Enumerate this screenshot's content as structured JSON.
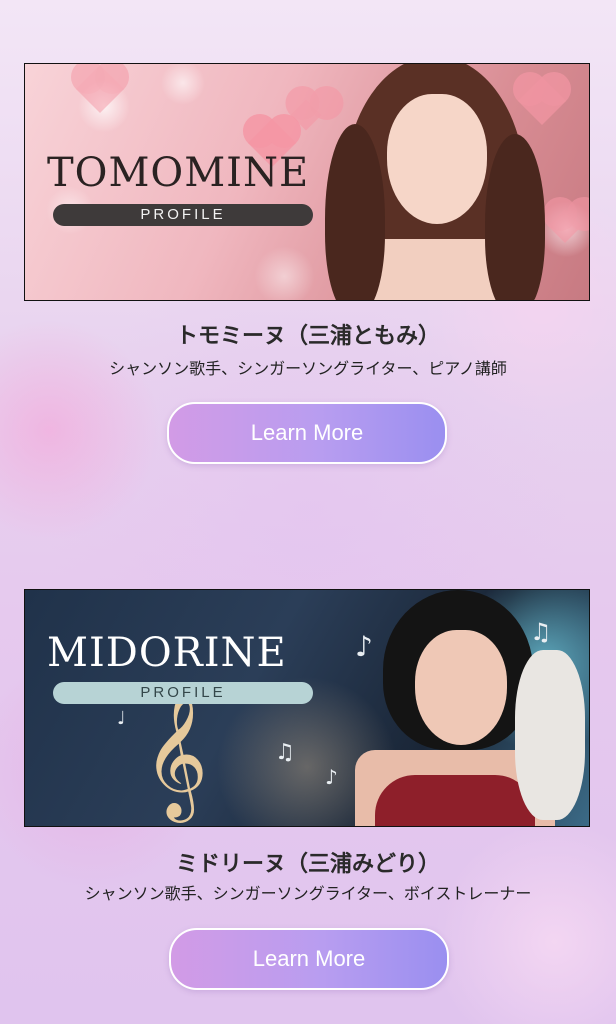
{
  "profiles": [
    {
      "banner_title": "TOMOMINE",
      "banner_subtitle": "PROFILE",
      "name": "トモミーヌ（三浦ともみ）",
      "description": "シャンソン歌手、シンガーソングライター、ピアノ講師",
      "button_label": "Learn More"
    },
    {
      "banner_title": "MIDORINE",
      "banner_subtitle": "PROFILE",
      "name": "ミドリーヌ（三浦みどり）",
      "description": "シャンソン歌手、シンガーソングライター、ボイストレーナー",
      "button_label": "Learn More"
    }
  ],
  "colors": {
    "button_gradient_start": "#d29be6",
    "button_gradient_end": "#9a8ff0",
    "tomomine_banner": "#f0b7bf",
    "midorine_banner": "#20324a"
  },
  "icons": {
    "clef": "treble-clef-icon",
    "notes": "music-note-icon",
    "hearts": "heart-icon"
  }
}
